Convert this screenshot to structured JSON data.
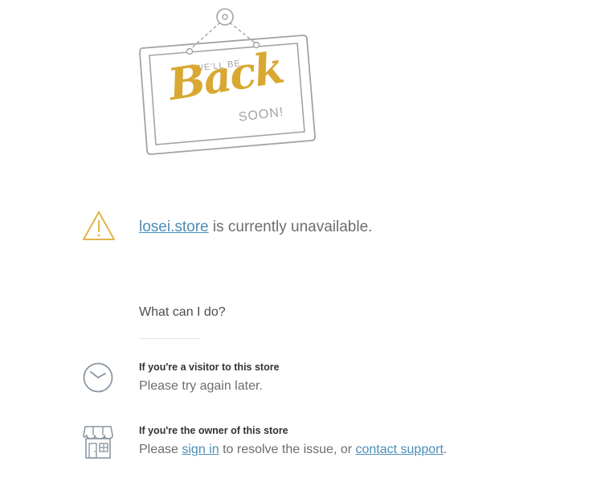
{
  "sign": {
    "top_text": "WE'LL BE",
    "main_text": "Back",
    "bottom_text": "SOON!",
    "accent_color": "#d9a832",
    "line_color": "#a3a3a3"
  },
  "alert": {
    "icon": "warning-icon",
    "icon_color": "#e0b54a",
    "domain_link": "losei.store",
    "message_suffix": " is currently unavailable."
  },
  "help": {
    "question": "What can I do?",
    "visitor": {
      "icon": "clock-icon",
      "title": "If you're a visitor to this store",
      "body": "Please try again later."
    },
    "owner": {
      "icon": "storefront-icon",
      "title": "If you're the owner of this store",
      "body_prefix": "Please ",
      "sign_in_link": "sign in",
      "body_middle": " to resolve the issue, or ",
      "support_link": "contact support",
      "body_suffix": "."
    },
    "link_color": "#4a8db7",
    "icon_color": "#8a97a3"
  }
}
